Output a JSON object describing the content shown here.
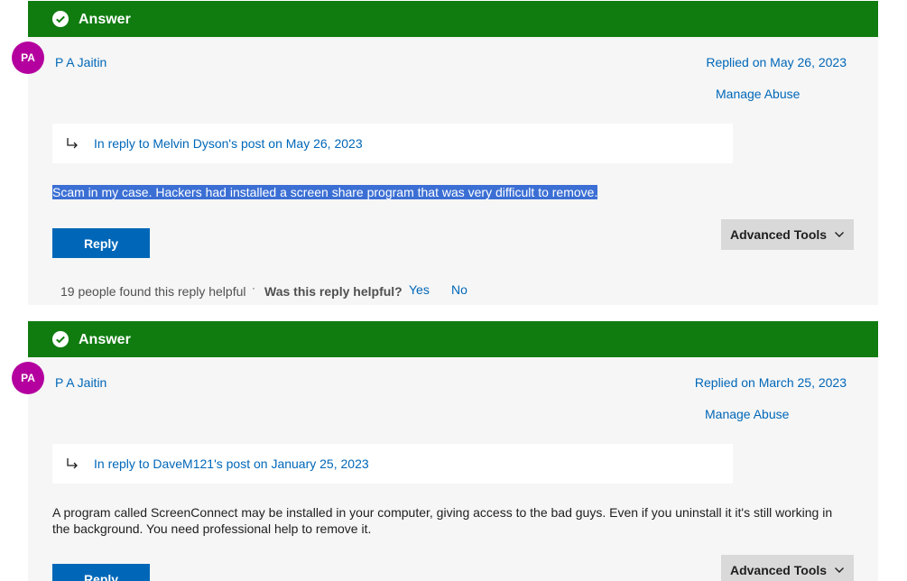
{
  "colors": {
    "answer_green": "#107c10",
    "link_blue": "#0067b8",
    "avatar_magenta": "#b4009e",
    "selection": "#3b6fd4"
  },
  "replies": [
    {
      "banner_label": "Answer",
      "avatar_initials": "PA",
      "author": "P A Jaitin",
      "replied_on": "Replied on May 26, 2023",
      "manage_abuse": "Manage Abuse",
      "in_reply_to": "In reply to Melvin Dyson's post on May 26, 2023",
      "body_selected": "Scam in my case. Hackers had installed a screen share program that was very difficult to remove.",
      "reply_label": "Reply",
      "advanced_tools_label": "Advanced Tools",
      "helpful_count": "19 people found this reply helpful",
      "separator": "·",
      "helpful_question": "Was this reply helpful?",
      "yes_label": "Yes",
      "no_label": "No"
    },
    {
      "banner_label": "Answer",
      "avatar_initials": "PA",
      "author": "P A Jaitin",
      "replied_on": "Replied on March 25, 2023",
      "manage_abuse": "Manage Abuse",
      "in_reply_to": "In reply to DaveM121's post on January 25, 2023",
      "body": "A program called ScreenConnect may be installed in your computer, giving access to the bad guys. Even if you uninstall it it's still working in the background. You need professional help to remove it.",
      "reply_label": "Reply",
      "advanced_tools_label": "Advanced Tools"
    }
  ]
}
